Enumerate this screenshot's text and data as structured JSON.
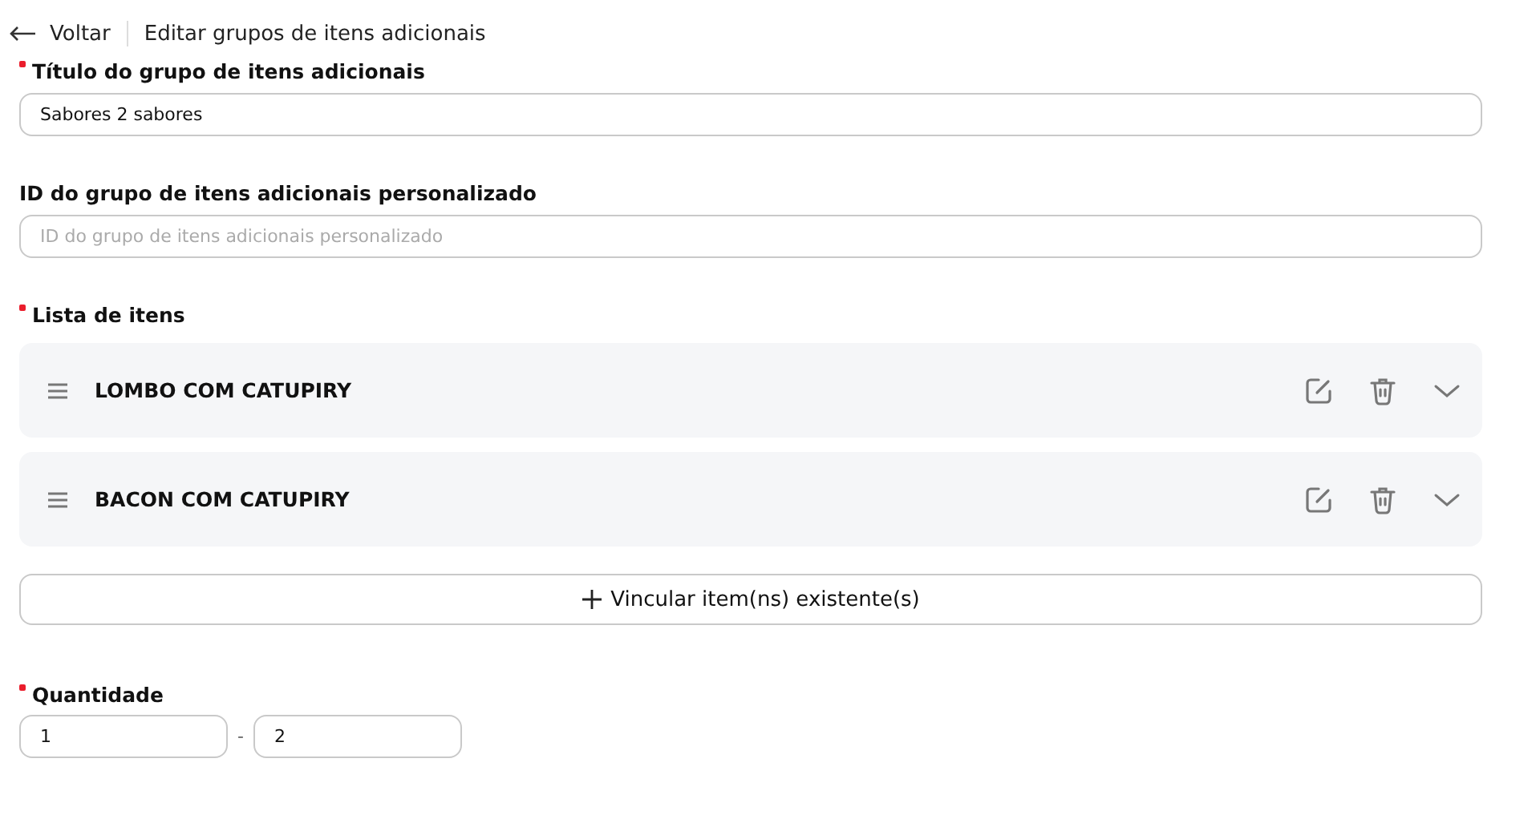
{
  "header": {
    "back_label": "Voltar",
    "title": "Editar grupos de itens adicionais"
  },
  "title_field": {
    "label": "Título do grupo de itens adicionais",
    "required": true,
    "value": "Sabores 2 sabores"
  },
  "id_field": {
    "label": "ID do grupo de itens adicionais personalizado",
    "required": false,
    "placeholder": "ID do grupo de itens adicionais personalizado"
  },
  "items_section": {
    "label": "Lista de itens",
    "required": true,
    "items": [
      {
        "name": "LOMBO COM CATUPIRY",
        "expanded": false
      },
      {
        "name": "BACON COM CATUPIRY",
        "expanded": false
      }
    ],
    "link_button": "Vincular item(ns) existente(s)"
  },
  "quantity": {
    "label": "Quantidade",
    "required": true,
    "min": "1",
    "separator": "-",
    "max": "2"
  }
}
